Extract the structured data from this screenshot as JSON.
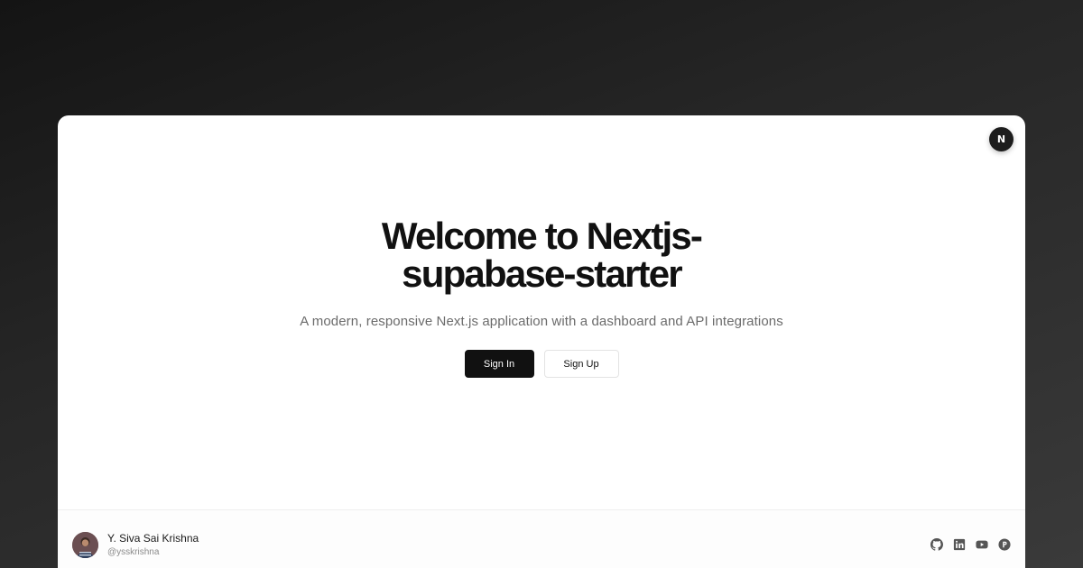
{
  "badge": {
    "letter": "N",
    "icon": "nextjs-logo-icon"
  },
  "hero": {
    "title": "Welcome to Nextjs-supabase-starter",
    "subtitle": "A modern, responsive Next.js application with a dashboard and API integrations"
  },
  "actions": {
    "sign_in_label": "Sign In",
    "sign_up_label": "Sign Up"
  },
  "footer": {
    "author_name": "Y. Siva Sai Krishna",
    "author_handle": "@ysskrishna",
    "socials": [
      {
        "icon": "github-icon"
      },
      {
        "icon": "linkedin-icon"
      },
      {
        "icon": "youtube-icon"
      },
      {
        "icon": "producthunt-icon"
      }
    ]
  },
  "colors": {
    "primary": "#111111",
    "muted_text": "#6b6b6b",
    "icon_gray": "#555555"
  }
}
